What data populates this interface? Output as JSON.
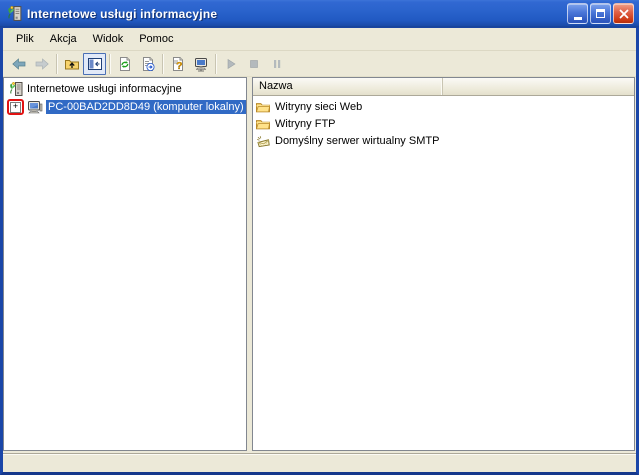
{
  "window": {
    "title": "Internetowe usługi informacyjne",
    "icon": "iis-icon"
  },
  "menu": {
    "items": [
      {
        "label": "Plik"
      },
      {
        "label": "Akcja"
      },
      {
        "label": "Widok"
      },
      {
        "label": "Pomoc"
      }
    ]
  },
  "toolbar": {
    "buttons": [
      {
        "name": "back-button",
        "icon": "back-arrow-icon",
        "enabled": true
      },
      {
        "name": "forward-button",
        "icon": "forward-arrow-icon",
        "enabled": false
      },
      {
        "name": "up-one-level-button",
        "icon": "up-folder-icon",
        "enabled": true
      },
      {
        "name": "show-hide-console-tree-button",
        "icon": "console-tree-icon",
        "pressed": true
      },
      {
        "name": "refresh-button",
        "icon": "refresh-icon",
        "enabled": true
      },
      {
        "name": "export-list-button",
        "icon": "export-list-icon",
        "enabled": true
      },
      {
        "name": "help-button",
        "icon": "help-icon",
        "enabled": true
      },
      {
        "name": "connect-computer-button",
        "icon": "computer-icon",
        "enabled": true
      },
      {
        "name": "start-button",
        "icon": "play-icon",
        "enabled": false
      },
      {
        "name": "stop-button",
        "icon": "stop-icon",
        "enabled": false
      },
      {
        "name": "pause-button",
        "icon": "pause-icon",
        "enabled": false
      }
    ]
  },
  "tree": {
    "root": {
      "label": "Internetowe usługi informacyjne",
      "icon": "iis-icon"
    },
    "server": {
      "label": "PC-00BAD2DD8D49 (komputer lokalny)",
      "icon": "computer-icon",
      "expander_glyph": "+",
      "selected": true,
      "expander_highlighted_red": true
    }
  },
  "list": {
    "columns": [
      {
        "label": "Nazwa"
      }
    ],
    "items": [
      {
        "label": "Witryny sieci Web",
        "icon": "folder-icon"
      },
      {
        "label": "Witryny FTP",
        "icon": "folder-icon"
      },
      {
        "label": "Domyślny serwer wirtualny SMTP",
        "icon": "smtp-envelope-icon"
      }
    ]
  },
  "colors": {
    "titlebar_blue": "#2a63cc",
    "window_border": "#1a46a8",
    "chrome_beige": "#ece9d8",
    "selection_blue": "#316ac5",
    "close_red": "#cc3812",
    "annotation_red": "#e11212"
  }
}
